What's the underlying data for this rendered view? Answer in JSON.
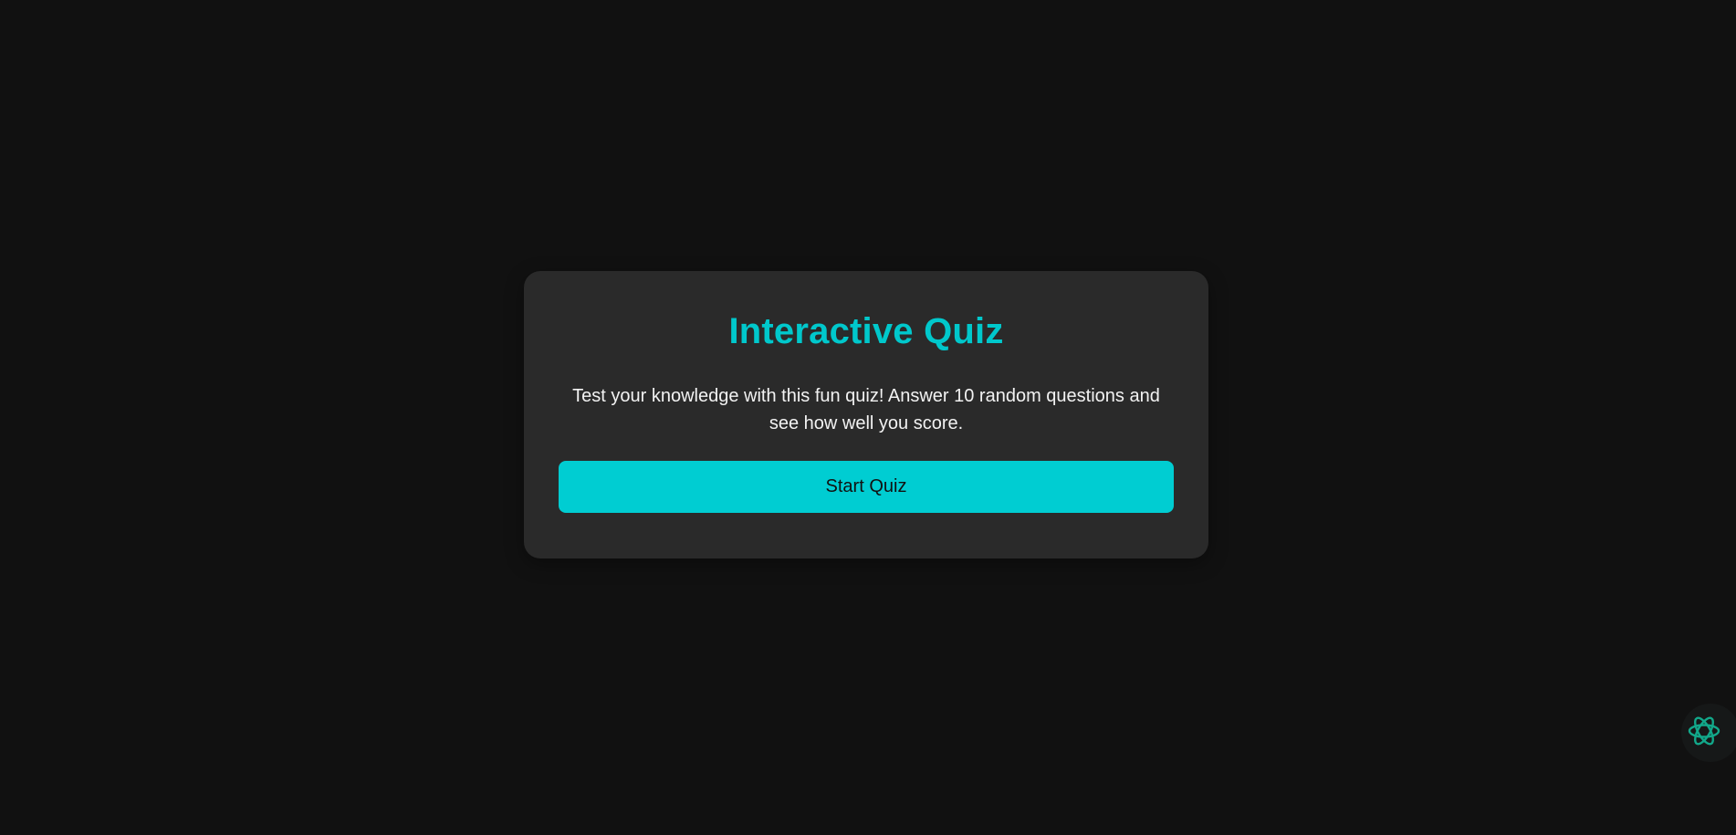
{
  "quiz": {
    "title": "Interactive Quiz",
    "description": "Test your knowledge with this fun quiz! Answer 10 random questions and see how well you score.",
    "start_label": "Start Quiz"
  },
  "floating_widget": {
    "icon": "atom-knot-icon",
    "color": "#12a88a"
  },
  "colors": {
    "background": "#111111",
    "card": "#2a2a2a",
    "accent": "#00c8cc",
    "button": "#00cdd2",
    "text": "#f2f2f2"
  }
}
